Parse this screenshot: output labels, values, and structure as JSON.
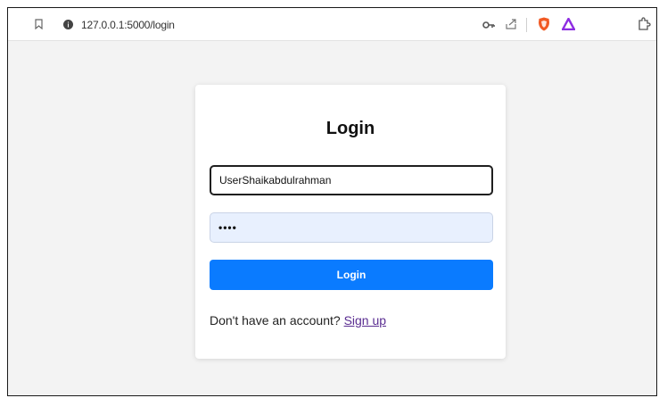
{
  "browser": {
    "url": "127.0.0.1:5000/login",
    "icons": [
      "bookmark-icon",
      "info-icon",
      "key-icon",
      "share-icon",
      "brave-shield-icon",
      "brave-rewards-icon",
      "extensions-icon"
    ]
  },
  "login_form": {
    "title": "Login",
    "username_value": "UserShaikabdulrahman",
    "password_value": "••••",
    "submit_label": "Login",
    "signup_prompt": "Don't have an account? ",
    "signup_link": "Sign up"
  },
  "colors": {
    "accent": "#0a7bff",
    "link": "#5a2d91",
    "password_bg": "#e8f0fe",
    "page_bg": "#f3f3f3"
  }
}
